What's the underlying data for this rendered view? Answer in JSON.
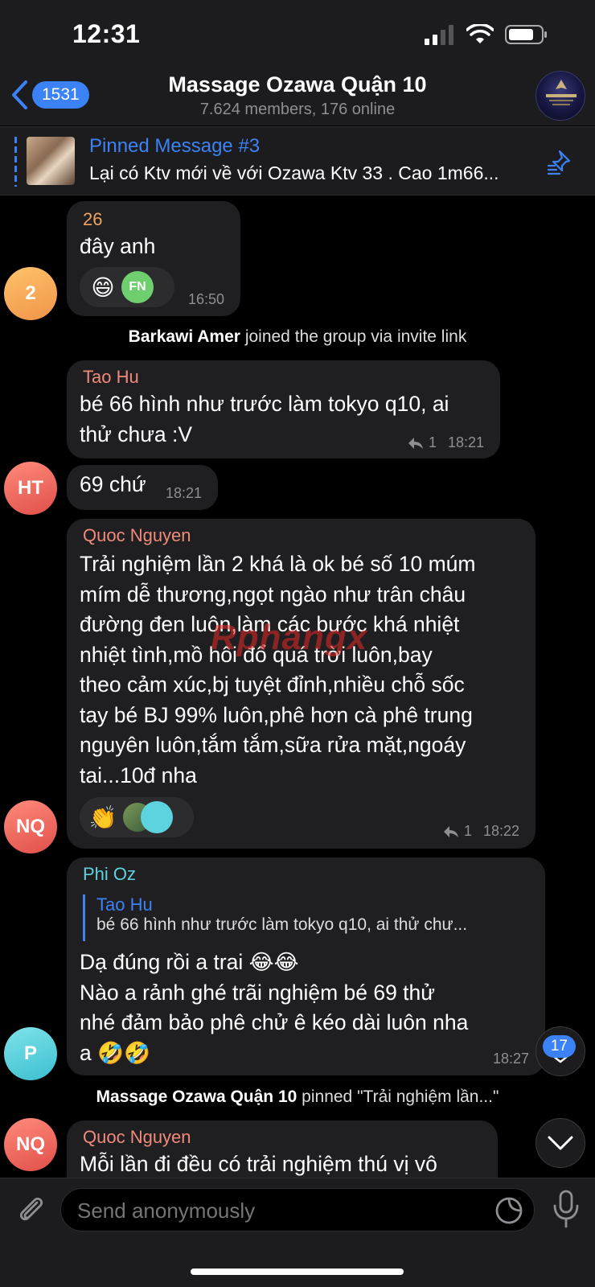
{
  "status_bar": {
    "time": "12:31"
  },
  "header": {
    "back_count": "1531",
    "title": "Massage Ozawa Quận 10",
    "subtitle": "7.624 members, 176 online"
  },
  "pinned": {
    "title": "Pinned Message #3",
    "text": "Lại có Ktv mới về với Ozawa Ktv 33 . Cao 1m66..."
  },
  "messages": [
    {
      "sender": "26",
      "text": "đây anh",
      "time": "16:50",
      "avatar": "2",
      "reaction_avatar": "FN"
    },
    {
      "service": {
        "name": "Barkawi Amer",
        "action": "joined the group via invite link"
      }
    },
    {
      "sender": "Tao Hu",
      "text_lines": [
        "bé 66 hình như trước làm tokyo q10, ai",
        "thử chưa :V"
      ],
      "replies": "1",
      "time": "18:21"
    },
    {
      "text": "69 chứ",
      "time": "18:21",
      "avatar": "HT"
    },
    {
      "sender": "Quoc Nguyen",
      "text_lines": [
        "Trải nghiệm lần 2 khá là ok bé số 10 múm",
        "mím dễ thương,ngọt ngào như trân châu",
        "đường đen luôn,làm các bước khá nhiệt",
        "nhiệt tình,mồ hôi đổ quá trời luôn,bay",
        "theo cảm xúc,bj tuyệt đỉnh,nhiều chỗ sốc",
        "tay bé BJ 99% luôn,phê hơn cà phê trung",
        "nguyên luôn,tắm tắm,sữa rửa mặt,ngoáy",
        "tai...10đ nha"
      ],
      "replies": "1",
      "time": "18:22",
      "avatar": "NQ"
    },
    {
      "sender": "Phi Oz",
      "reply_to": {
        "sender": "Tao Hu",
        "text": "bé 66 hình như trước làm tokyo q10, ai thử chư..."
      },
      "text_lines": [
        "Dạ đúng rồi a trai 😂😂",
        "Nào a rảnh  ghé trãi nghiệm bé 69 thử",
        "nhé đảm bảo phê chử ê kéo dài luôn nha",
        "a 🤣🤣"
      ],
      "time": "18:27",
      "avatar": "P"
    },
    {
      "service": {
        "name": "Massage Ozawa Quận 10",
        "action": "pinned \"Trải nghiệm lần...\""
      }
    },
    {
      "sender": "Quoc Nguyen",
      "text": "Mỗi lần đi đều có trải nghiệm thú vị vô",
      "avatar": "NQ"
    }
  ],
  "floating": {
    "reactions_count": "17"
  },
  "input": {
    "placeholder": "Send anonymously"
  },
  "watermark": "Rphangx",
  "colors": {
    "accent": "#3b82f6",
    "bubble": "#1f1f21",
    "sender_orange": "#f0a35e",
    "sender_salmon": "#f08a7a",
    "sender_cyan": "#5ed3e0"
  }
}
